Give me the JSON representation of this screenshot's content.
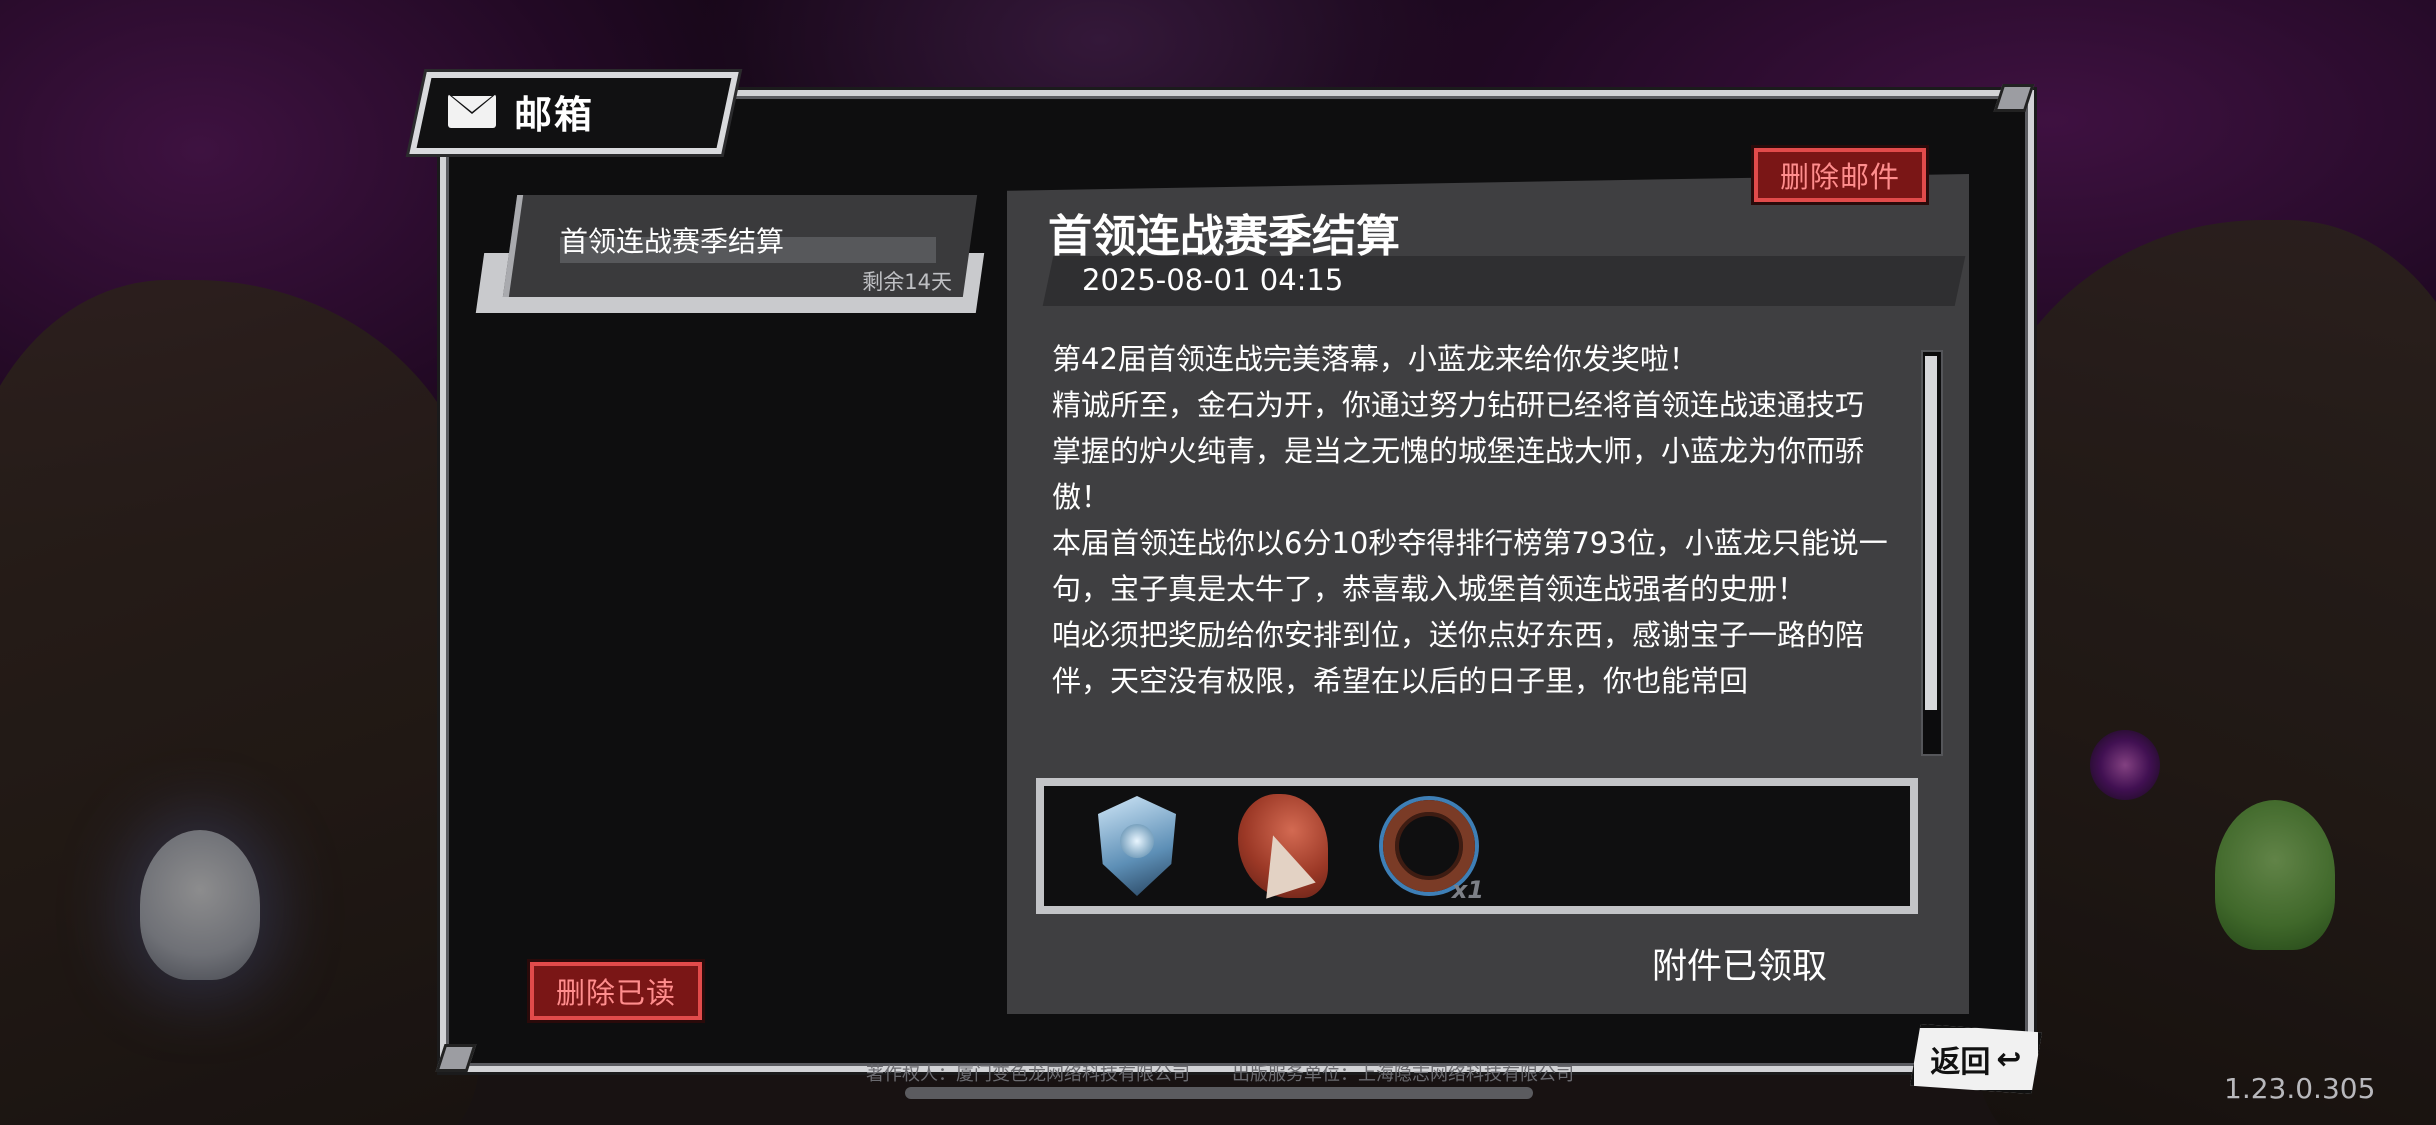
{
  "window": {
    "title": "邮箱",
    "icon": "mail-icon"
  },
  "mail_list": {
    "items": [
      {
        "title": "首领连战赛季结算",
        "expire": "剩余14天",
        "selected": true
      }
    ],
    "delete_read_label": "删除已读"
  },
  "mail_detail": {
    "delete_label": "删除邮件",
    "title": "首领连战赛季结算",
    "date": "2025-08-01 04:15",
    "body": [
      "第42届首领连战完美落幕，小蓝龙来给你发奖啦！",
      "精诚所至，金石为开，你通过努力钻研已经将首领连战速通技巧掌握的炉火纯青，是当之无愧的城堡连战大师，小蓝龙为你而骄傲！",
      "本届首领连战你以6分10秒夺得排行榜第793位，小蓝龙只能说一句，宝子真是太牛了，恭喜载入城堡首领连战强者的史册！",
      "咱必须把奖励给你安排到位，送你点好东西，感谢宝子一路的陪伴，天空没有极限，希望在以后的日子里，你也能常回"
    ],
    "attachments": [
      {
        "icon": "blue-shield-badge-icon",
        "quantity": ""
      },
      {
        "icon": "red-claw-fragment-icon",
        "quantity": ""
      },
      {
        "icon": "bronze-ring-icon",
        "quantity": "x1"
      }
    ],
    "claim_status": "附件已领取"
  },
  "footer": {
    "back_label": "返回",
    "copyright": "著作权人：厦门变色龙网络科技有限公司",
    "publisher": "出版服务单位：上海隐志网络科技有限公司",
    "version": "1.23.0.305"
  },
  "colors": {
    "accent_red": "#e24b4b",
    "panel_border": "#d2d3d6",
    "panel_bg": "#0e0e0f"
  }
}
